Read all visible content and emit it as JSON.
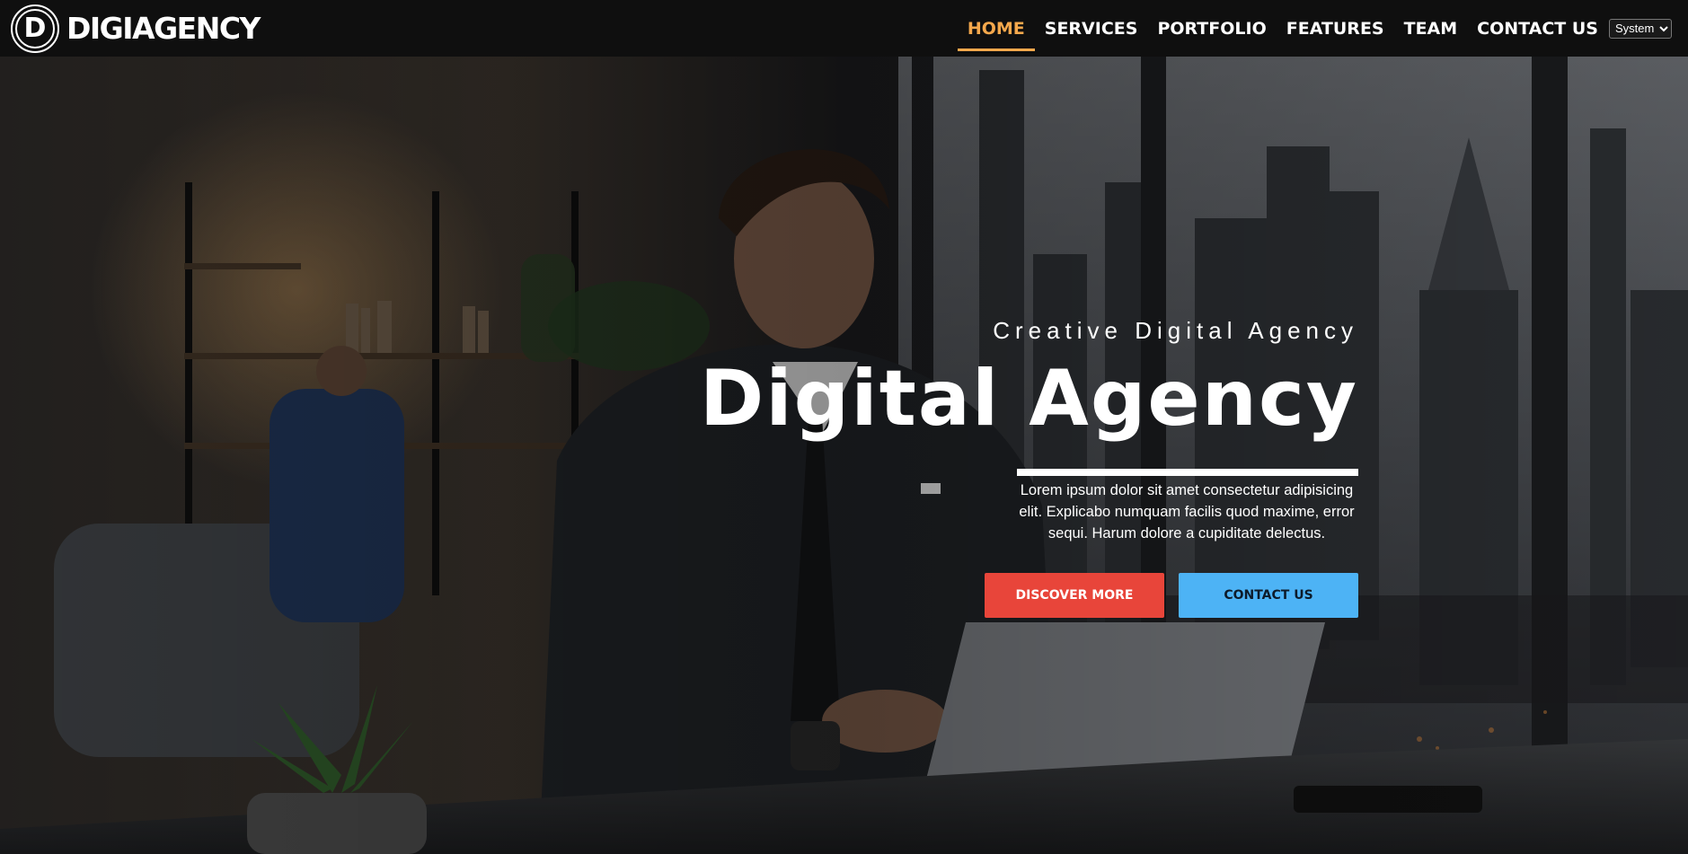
{
  "brand": {
    "logo_letter": "D",
    "name": "DIGIAGENCY"
  },
  "nav": {
    "items": [
      {
        "label": "HOME",
        "active": true
      },
      {
        "label": "SERVICES",
        "active": false
      },
      {
        "label": "PORTFOLIO",
        "active": false
      },
      {
        "label": "FEATURES",
        "active": false
      },
      {
        "label": "TEAM",
        "active": false
      },
      {
        "label": "CONTACT US",
        "active": false
      }
    ],
    "theme_select": {
      "selected": "System"
    }
  },
  "hero": {
    "subtitle": "Creative Digital Agency",
    "title": "Digital Agency",
    "description": "Lorem ipsum dolor sit amet consectetur adipisicing elit. Explicabo numquam facilis quod maxime, error sequi. Harum dolore a cupiditate delectus.",
    "primary_button": "DISCOVER MORE",
    "secondary_button": "CONTACT US"
  },
  "colors": {
    "nav_bg": "#0f0f0f",
    "active_accent": "#f5a84c",
    "primary_button": "#e8453a",
    "secondary_button": "#4db3f5"
  }
}
